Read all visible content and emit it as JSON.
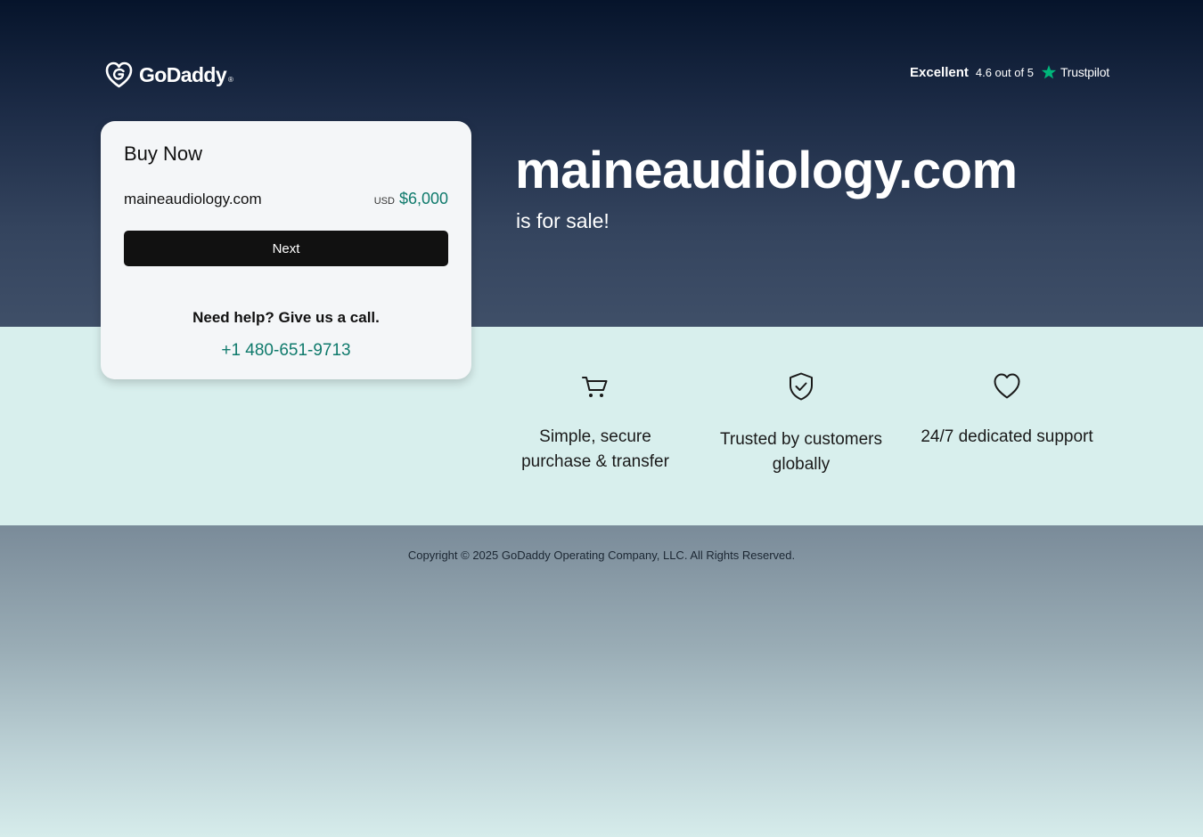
{
  "header": {
    "logo_text": "GoDaddy",
    "logo_tm": "®",
    "rating": {
      "label": "Excellent",
      "score_text": "4.6 out of 5",
      "brand": "Trustpilot",
      "icon": "star-icon"
    }
  },
  "purchase_card": {
    "title": "Buy Now",
    "domain": "maineaudiology.com",
    "currency": "USD",
    "price": "$6,000",
    "next_label": "Next",
    "help_text": "Need help? Give us a call.",
    "phone": "+1 480-651-9713"
  },
  "hero": {
    "domain": "maineaudiology.com",
    "tagline": "is for sale!"
  },
  "features": [
    {
      "icon": "cart-icon",
      "text": "Simple, secure purchase & transfer"
    },
    {
      "icon": "shield-check-icon",
      "text": "Trusted by customers globally"
    },
    {
      "icon": "heart-icon",
      "text": "24/7 dedicated support"
    }
  ],
  "footer": {
    "copyright": "Copyright © 2025 GoDaddy Operating Company, LLC. All Rights Reserved."
  },
  "colors": {
    "hero_top": "#06142b",
    "hero_bottom": "#3f4f68",
    "feature_band": "#d8efed",
    "accent_green": "#0f7a6c",
    "trustpilot_star": "#00b67a",
    "button_bg": "#111111"
  }
}
